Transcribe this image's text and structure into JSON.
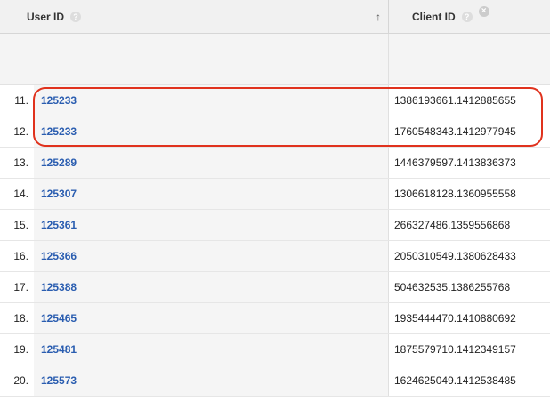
{
  "header": {
    "user_id_label": "User ID",
    "client_id_label": "Client ID",
    "help_glyph": "?",
    "sort_glyph": "↑",
    "close_glyph": "×"
  },
  "colors": {
    "link": "#2a5db0",
    "highlight": "#e0321d",
    "header_bg": "#f1f1f1"
  },
  "rows": [
    {
      "index": "11.",
      "user_id": "125233",
      "client_id": "1386193661.1412885655"
    },
    {
      "index": "12.",
      "user_id": "125233",
      "client_id": "1760548343.1412977945"
    },
    {
      "index": "13.",
      "user_id": "125289",
      "client_id": "1446379597.1413836373"
    },
    {
      "index": "14.",
      "user_id": "125307",
      "client_id": "1306618128.1360955558"
    },
    {
      "index": "15.",
      "user_id": "125361",
      "client_id": "266327486.1359556868"
    },
    {
      "index": "16.",
      "user_id": "125366",
      "client_id": "2050310549.1380628433"
    },
    {
      "index": "17.",
      "user_id": "125388",
      "client_id": "504632535.1386255768"
    },
    {
      "index": "18.",
      "user_id": "125465",
      "client_id": "1935444470.1410880692"
    },
    {
      "index": "19.",
      "user_id": "125481",
      "client_id": "1875579710.1412349157"
    },
    {
      "index": "20.",
      "user_id": "125573",
      "client_id": "1624625049.1412538485"
    }
  ]
}
